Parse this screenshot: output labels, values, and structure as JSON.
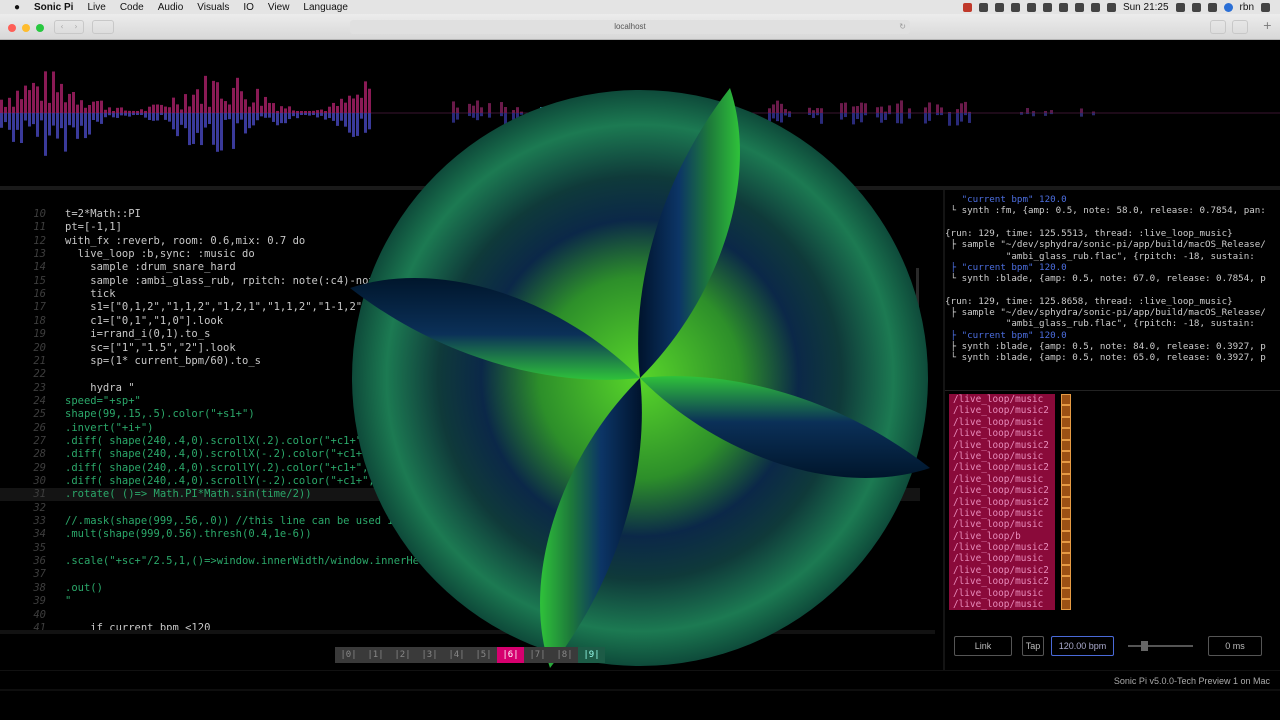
{
  "menubar": {
    "apple": "",
    "items": [
      "Sonic Pi",
      "Live",
      "Code",
      "Audio",
      "Visuals",
      "IO",
      "View",
      "Language"
    ],
    "clock": "Sun 21:25",
    "user": "rbn"
  },
  "browser": {
    "address": "localhost"
  },
  "editor": {
    "lines": [
      {
        "n": "10",
        "text": "t=2*Math::PI"
      },
      {
        "n": "11",
        "text": "pt=[-1,1]"
      },
      {
        "n": "12",
        "text": "with_fx :reverb, room: 0.6,mix: 0.7 do"
      },
      {
        "n": "13",
        "text": "  live_loop :b,sync: :music do"
      },
      {
        "n": "14",
        "text": "    sample :drum_snare_hard"
      },
      {
        "n": "15",
        "text": "    sample :ambi_glass_rub, rpitch: note(:c4)-note(:fs4)+[0,-12].choose"
      },
      {
        "n": "16",
        "text": "    tick"
      },
      {
        "n": "17",
        "text": "    s1=[\"0,1,2\",\"1,1,2\",\"1,2,1\",\"1,1,2\",\"1-1,2\"].look"
      },
      {
        "n": "18",
        "text": "    c1=[\"0,1\",\"1,0\"].look"
      },
      {
        "n": "19",
        "text": "    i=rrand_i(0,1).to_s"
      },
      {
        "n": "20",
        "text": "    sc=[\"1\",\"1.5\",\"2\"].look"
      },
      {
        "n": "21",
        "text": "    sp=(1* current_bpm/60).to_s"
      },
      {
        "n": "22",
        "text": ""
      },
      {
        "n": "23",
        "text": "    hydra \""
      },
      {
        "n": "24",
        "text": "speed=\"+sp+\""
      },
      {
        "n": "25",
        "text": "shape(99,.15,.5).color(\"+s1+\")"
      },
      {
        "n": "26",
        "text": ".invert(\"+i+\")"
      },
      {
        "n": "27",
        "text": ".diff( shape(240,.4,0).scrollX(.2).color(\"+c1+\",.75))"
      },
      {
        "n": "28",
        "text": ".diff( shape(240,.4,0).scrollX(-.2).color(\"+c1+\",.75))"
      },
      {
        "n": "29",
        "text": ".diff( shape(240,.4,0).scrollY(.2).color(\"+c1+\",.75))"
      },
      {
        "n": "30",
        "text": ".diff( shape(240,.4,0).scrollY(-.2).color(\"+c1+\",.75))"
      },
      {
        "n": "31",
        "text": ".rotate( ()=> Math.PI*Math.sin(time/2))"
      },
      {
        "n": "32",
        "text": ""
      },
      {
        "n": "33",
        "text": "//.mask(shape(999,.56,.0)) //this line can be used instead of the following"
      },
      {
        "n": "34",
        "text": ".mult(shape(999,0.56).thresh(0.4,1e-6))"
      },
      {
        "n": "35",
        "text": ""
      },
      {
        "n": "36",
        "text": ".scale(\"+sc+\"/2.5,1,()=>window.innerWidth/window.innerHeight)"
      },
      {
        "n": "37",
        "text": ""
      },
      {
        "n": "38",
        "text": ".out()"
      },
      {
        "n": "39",
        "text": "\""
      },
      {
        "n": "40",
        "text": ""
      },
      {
        "n": "41",
        "text": "    if current_bpm <120"
      }
    ]
  },
  "buffers": [
    "|0|",
    "|1|",
    "|2|",
    "|3|",
    "|4|",
    "|5|",
    "|6|",
    "|7|",
    "|8|",
    "|9|"
  ],
  "log": {
    "lines": [
      {
        "kind": "bpm",
        "text": "   \"current bpm\" 120.0"
      },
      {
        "kind": "body",
        "text": " └ synth :fm, {amp: 0.5, note: 58.0, release: 0.7854, pan:"
      },
      {
        "kind": "blank",
        "text": ""
      },
      {
        "kind": "run",
        "text": "{run: 129, time: 125.5513, thread: :live_loop_music}"
      },
      {
        "kind": "body",
        "text": " ├ sample \"~/dev/sphydra/sonic-pi/app/build/macOS_Release/"
      },
      {
        "kind": "body",
        "text": "           \"ambi_glass_rub.flac\", {rpitch: -18, sustain:"
      },
      {
        "kind": "bpm",
        "text": " ├ \"current bpm\" 120.0"
      },
      {
        "kind": "body",
        "text": " └ synth :blade, {amp: 0.5, note: 67.0, release: 0.7854, p"
      },
      {
        "kind": "blank",
        "text": ""
      },
      {
        "kind": "run",
        "text": "{run: 129, time: 125.8658, thread: :live_loop_music}"
      },
      {
        "kind": "body",
        "text": " ├ sample \"~/dev/sphydra/sonic-pi/app/build/macOS_Release/"
      },
      {
        "kind": "body",
        "text": "           \"ambi_glass_rub.flac\", {rpitch: -18, sustain:"
      },
      {
        "kind": "bpm",
        "text": " ├ \"current bpm\" 120.0"
      },
      {
        "kind": "body",
        "text": " ├ synth :blade, {amp: 0.5, note: 84.0, release: 0.3927, p"
      },
      {
        "kind": "body",
        "text": " └ synth :blade, {amp: 0.5, note: 65.0, release: 0.3927, p"
      }
    ]
  },
  "cues": [
    "/live_loop/music",
    "/live_loop/music2",
    "/live_loop/music",
    "/live_loop/music",
    "/live_loop/music2",
    "/live_loop/music",
    "/live_loop/music2",
    "/live_loop/music",
    "/live_loop/music2",
    "/live_loop/music2",
    "/live_loop/music",
    "/live_loop/music",
    "/live_loop/b",
    "/live_loop/music2",
    "/live_loop/music",
    "/live_loop/music2",
    "/live_loop/music2",
    "/live_loop/music",
    "/live_loop/music"
  ],
  "controls": {
    "link": "Link",
    "tap": "Tap",
    "bpm": "120.00 bpm",
    "latency": "0 ms"
  },
  "footer": {
    "version": "Sonic Pi v5.0.0-Tech Preview 1 on Mac"
  }
}
